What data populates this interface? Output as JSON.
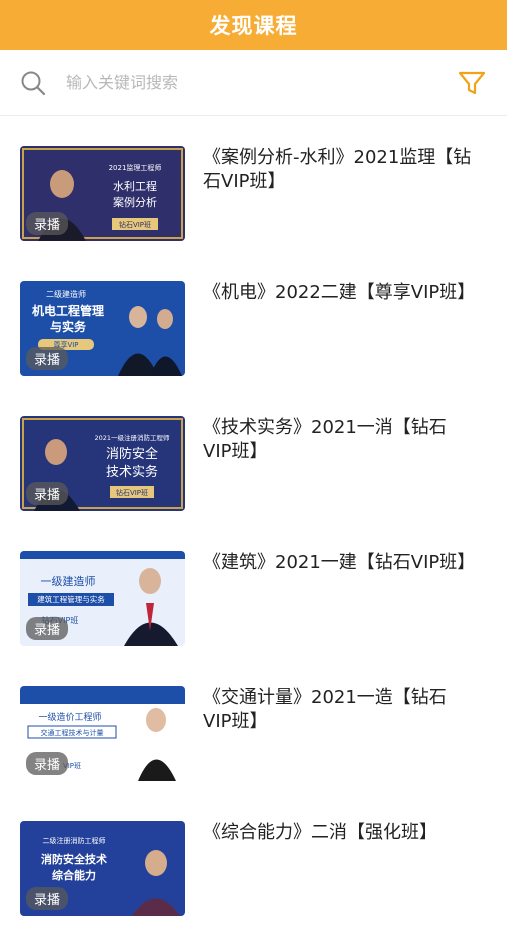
{
  "header": {
    "title": "发现课程"
  },
  "search": {
    "placeholder": "输入关键词搜索"
  },
  "courses": [
    {
      "title": "《案例分析-水利》2021监理【钻石VIP班】",
      "badge": "录播",
      "thumb": {
        "caption_top": "2021监理工程师",
        "line1": "水利工程",
        "line2": "案例分析",
        "tag": "钻石VIP班"
      }
    },
    {
      "title": "《机电》2022二建【尊享VIP班】",
      "badge": "录播",
      "thumb": {
        "caption_top": "二级建造师",
        "line1": "机电工程管理",
        "line2": "与实务",
        "tag": "尊享VIP"
      }
    },
    {
      "title": "《技术实务》2021一消【钻石VIP班】",
      "badge": "录播",
      "thumb": {
        "caption_top": "2021一级注册消防工程师",
        "line1": "消防安全",
        "line2": "技术实务",
        "tag": "钻石VIP班"
      }
    },
    {
      "title": "《建筑》2021一建【钻石VIP班】",
      "badge": "录播",
      "thumb": {
        "caption_top": "一级建造师",
        "line1": "建筑工程管理与实务",
        "line2": "",
        "tag": "钻石VIP班"
      }
    },
    {
      "title": "《交通计量》2021一造【钻石VIP班】",
      "badge": "录播",
      "thumb": {
        "caption_top": "一级造价工程师",
        "line1": "交通工程技术与计量",
        "line2": "",
        "tag": "VIP班"
      }
    },
    {
      "title": "《综合能力》二消【强化班】",
      "badge": "录播",
      "thumb": {
        "caption_top": "二级注册消防工程师",
        "line1": "消防安全技术",
        "line2": "综合能力",
        "tag": ""
      }
    }
  ],
  "colors": {
    "header": "#f7ad35",
    "thumb_dark": "#2b3a78",
    "thumb_blue": "#1d4fa8",
    "thumb_light": "#e9f0fb"
  }
}
